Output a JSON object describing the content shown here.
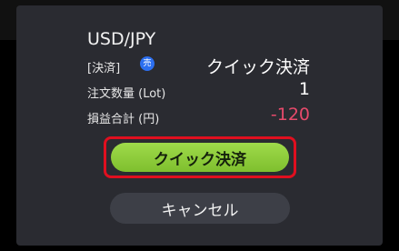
{
  "dialog": {
    "pair": "USD/JPY",
    "settlement_label": "[決済]",
    "side_badge": "売",
    "settlement_type": "クイック決済",
    "quantity_label": "注文数量 (Lot)",
    "quantity_value": "1",
    "pnl_label": "損益合計 (円)",
    "pnl_value": "-120",
    "quick_settle_button": "クイック決済",
    "cancel_button": "キャンセル"
  },
  "colors": {
    "dialog_bg": "#2a2b31",
    "pnl_negative": "#e64a6b",
    "primary_button": "#8fcc3c",
    "highlight_border": "#e00f1f",
    "badge": "#2c6ff0"
  }
}
